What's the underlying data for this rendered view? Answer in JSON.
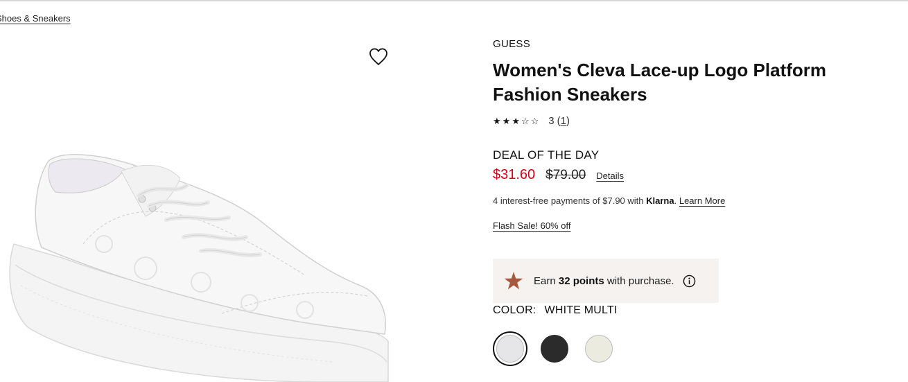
{
  "breadcrumb": {
    "label": "Shoes & Sneakers"
  },
  "product": {
    "brand": "GUESS",
    "title": "Women's Cleva Lace-up Logo Platform Fashion Sneakers",
    "rating": {
      "value": "3",
      "count": "1",
      "stars_filled": 3,
      "stars_total": 5
    },
    "deal_label": "DEAL OF THE DAY",
    "sale_price": "$31.60",
    "original_price": "$79.00",
    "details_label": "Details",
    "klarna": {
      "prefix": "4 interest-free payments of $7.90 with ",
      "brand": "Klarna",
      "separator": ".",
      "learn_more": "Learn More"
    },
    "flash_sale": "Flash Sale! 60% off",
    "points": {
      "prefix": "Earn ",
      "amount": "32 points",
      "suffix": " with purchase."
    },
    "color": {
      "label": "COLOR:",
      "value": "WHITE MULTI",
      "swatches": [
        {
          "name": "White Multi",
          "hex": "#e6e6e8",
          "selected": true
        },
        {
          "name": "Black",
          "hex": "#2b2b2b",
          "selected": false
        },
        {
          "name": "Cream",
          "hex": "#ecebe0",
          "selected": false
        }
      ]
    }
  },
  "icons": {
    "wishlist": "heart-outline-icon",
    "points": "star-icon",
    "info": "info-circle-icon"
  },
  "colors": {
    "sale_red": "#d0021b",
    "points_star": "#a9573e",
    "points_bg": "#f5f2ef"
  }
}
